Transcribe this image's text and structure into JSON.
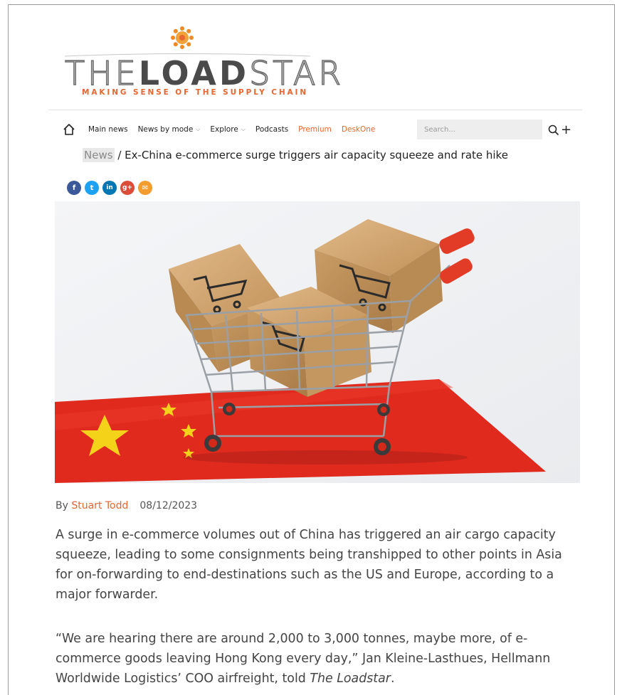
{
  "logo": {
    "the": "THE",
    "load": "LOAD",
    "star": "STAR",
    "tagline": "MAKING SENSE OF THE SUPPLY CHAIN"
  },
  "nav": {
    "items": [
      {
        "label": "Main news",
        "accent": false,
        "dropdown": false
      },
      {
        "label": "News by mode",
        "accent": false,
        "dropdown": true
      },
      {
        "label": "Explore",
        "accent": false,
        "dropdown": true
      },
      {
        "label": "Podcasts",
        "accent": false,
        "dropdown": false
      },
      {
        "label": "Premium",
        "accent": true,
        "dropdown": false
      },
      {
        "label": "DeskOne",
        "accent": true,
        "dropdown": false
      }
    ],
    "search_placeholder": "Search...",
    "search_button_label": "Q+"
  },
  "breadcrumb": {
    "section": "News",
    "separator": " / ",
    "title": "Ex-China e-commerce surge triggers air capacity squeeze and rate hike"
  },
  "share": [
    {
      "icon": "facebook-icon",
      "glyph": "f",
      "color": "#3b5998"
    },
    {
      "icon": "twitter-icon",
      "glyph": "t",
      "color": "#1da1f2"
    },
    {
      "icon": "linkedin-icon",
      "glyph": "in",
      "color": "#0077b5"
    },
    {
      "icon": "google-plus-icon",
      "glyph": "g+",
      "color": "#dd4b39"
    },
    {
      "icon": "email-icon",
      "glyph": "✉",
      "color": "#f39c2e"
    }
  ],
  "article": {
    "by": "By ",
    "author": "Stuart Todd",
    "date": "08/12/2023",
    "para1": "A surge in e-commerce volumes out of China has triggered an air cargo capacity squeeze, leading to some consignments being transhipped to other points in Asia for on-forwarding to end-destinations such as the US and Europe, according to a major forwarder.",
    "para2_a": "“We are hearing there are around 2,000 to 3,000 tonnes, maybe more, of e-commerce goods leaving Hong Kong every day,” Jan Kleine-Lasthues, Hellmann Worldwide Logistics’ COO airfreight, told ",
    "para2_em": "The Loadstar",
    "para2_b": "."
  },
  "colors": {
    "accent": "#e8662f",
    "flag_red": "#e02a1e",
    "star_yellow": "#f5d21a"
  }
}
